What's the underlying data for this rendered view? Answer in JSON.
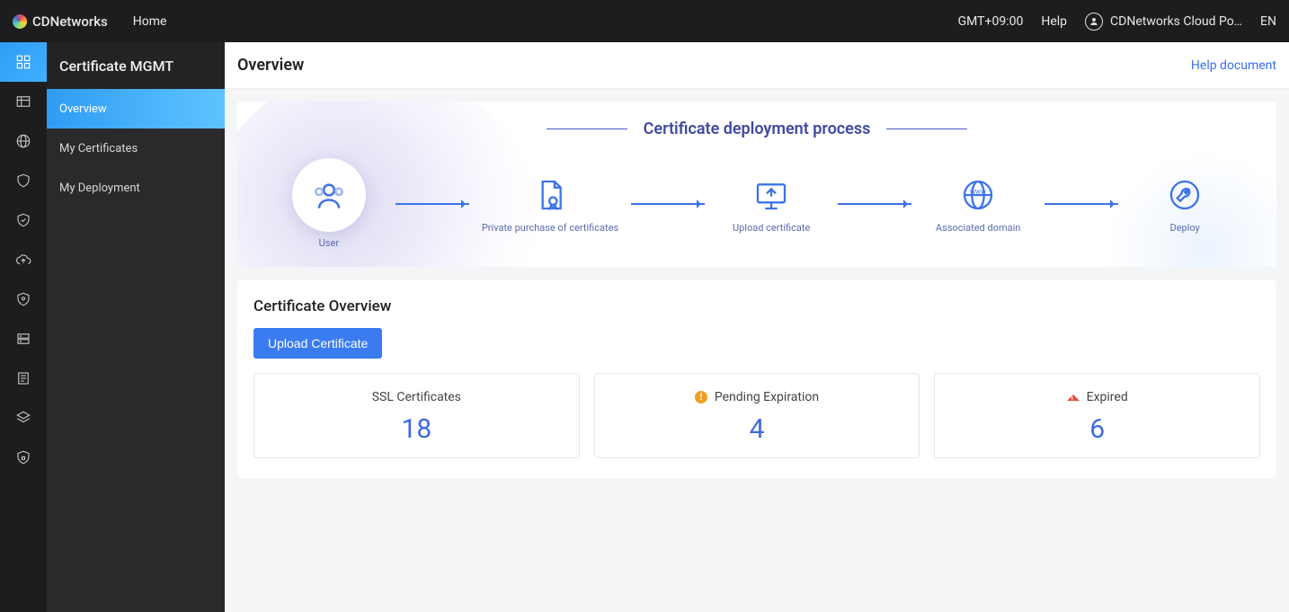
{
  "topbar": {
    "brand": "CDNetworks",
    "home": "Home",
    "timezone": "GMT+09:00",
    "help": "Help",
    "user_name": "CDNetworks Cloud Po…",
    "lang": "EN"
  },
  "sidebar": {
    "title": "Certificate MGMT",
    "items": [
      {
        "label": "Overview"
      },
      {
        "label": "My Certificates"
      },
      {
        "label": "My Deployment"
      }
    ]
  },
  "page": {
    "title": "Overview",
    "help_doc": "Help document"
  },
  "hero": {
    "title": "Certificate deployment process",
    "steps": [
      {
        "caption": "User"
      },
      {
        "caption": "Private purchase of certificates"
      },
      {
        "caption": "Upload certificate"
      },
      {
        "caption": "Associated domain"
      },
      {
        "caption": "Deploy"
      }
    ]
  },
  "overview": {
    "section_title": "Certificate Overview",
    "upload_btn": "Upload Certificate",
    "cards": [
      {
        "label": "SSL Certificates",
        "value": "18"
      },
      {
        "label": "Pending Expiration",
        "value": "4"
      },
      {
        "label": "Expired",
        "value": "6"
      }
    ]
  }
}
